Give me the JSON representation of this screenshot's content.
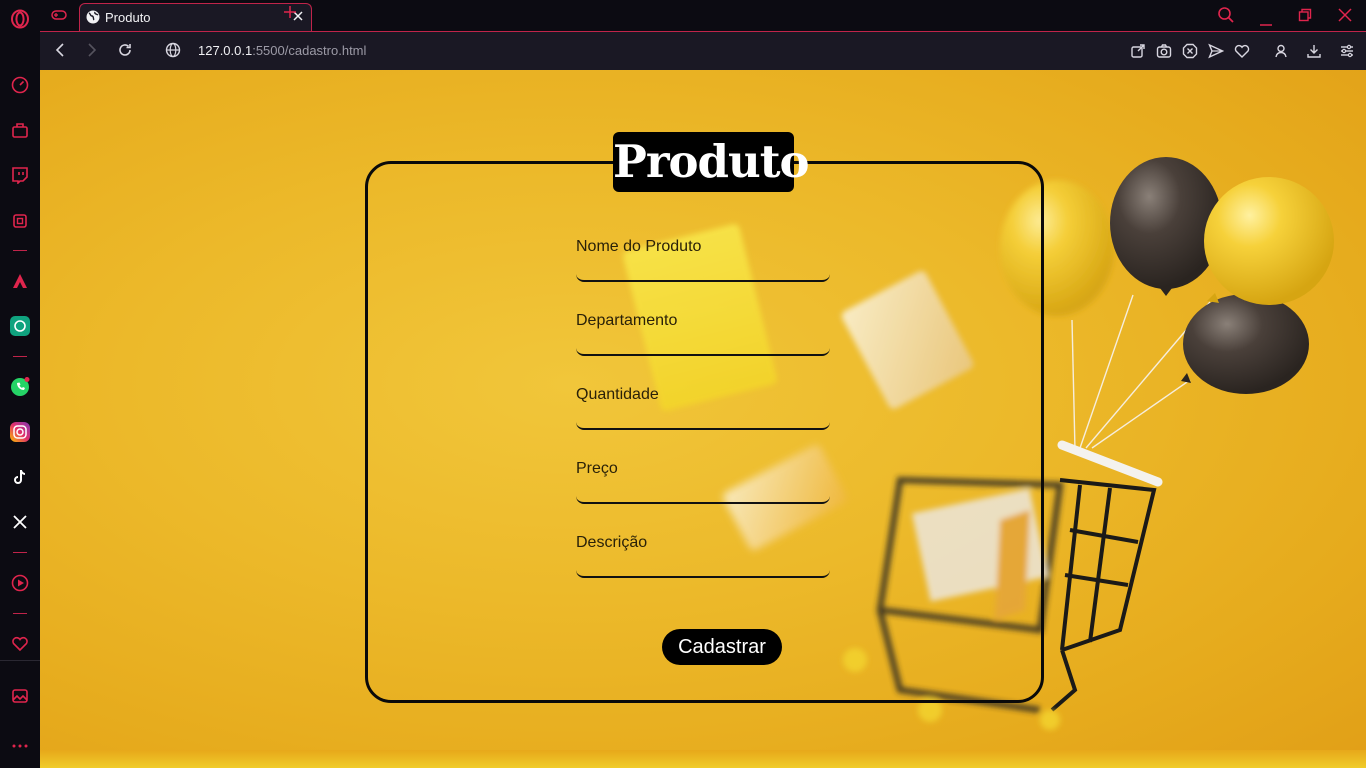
{
  "browser": {
    "tab": {
      "title": "Produto"
    },
    "address": {
      "host": "127.0.0.1",
      "path": ":5500/cadastro.html"
    }
  },
  "sidebar": {
    "items": [
      "speed-dial",
      "extensions",
      "twitch",
      "devices",
      "aria",
      "chatgpt",
      "whatsapp",
      "instagram",
      "tiktok",
      "x",
      "player",
      "favorites",
      "gallery",
      "more"
    ]
  },
  "form": {
    "title": "Produto",
    "fields": [
      {
        "label": "Nome do Produto",
        "value": ""
      },
      {
        "label": "Departamento",
        "value": ""
      },
      {
        "label": "Quantidade",
        "value": ""
      },
      {
        "label": "Preço",
        "value": ""
      },
      {
        "label": "Descrição",
        "value": ""
      }
    ],
    "submit_label": "Cadastrar"
  },
  "colors": {
    "accent": "#c0244a",
    "page_background": "#ecb92a",
    "card_border": "#0a0a0a"
  }
}
